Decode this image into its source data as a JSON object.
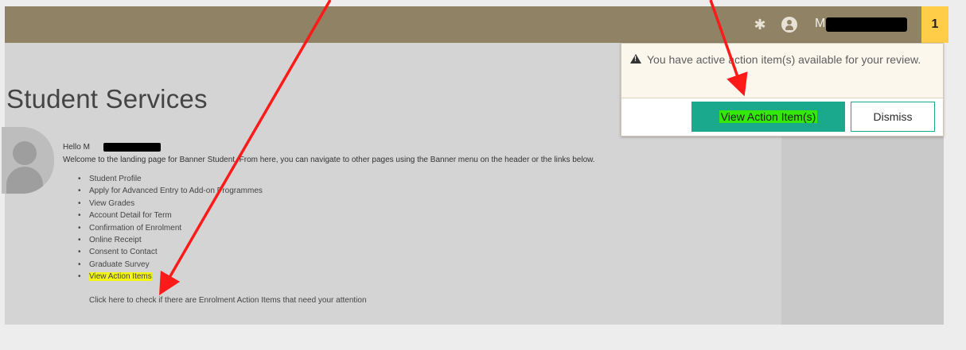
{
  "header": {
    "user_initial": "M",
    "notification_count": "1"
  },
  "main": {
    "title": "Student Services",
    "greeting": "Hello M",
    "welcome": "Welcome to the landing page for Banner Student. From here, you can navigate to other pages using the Banner menu on the header or the links below.",
    "links": [
      {
        "label": "Student Profile"
      },
      {
        "label": "Apply for Advanced Entry to Add-on Programmes"
      },
      {
        "label": "View Grades"
      },
      {
        "label": "Account Detail for Term"
      },
      {
        "label": "Confirmation of Enrolment"
      },
      {
        "label": "Online Receipt"
      },
      {
        "label": "Consent to Contact"
      },
      {
        "label": "Graduate Survey"
      },
      {
        "label": "View Action Items"
      }
    ],
    "action_items_description": "Click here to check if there are Enrolment Action Items that need your attention"
  },
  "popup": {
    "message": "You have active action item(s) available for your review.",
    "view_button": "View Action Item(s)",
    "dismiss_button": "Dismiss"
  },
  "colors": {
    "header_bg": "#8f8265",
    "notification_badge": "#ffcd48",
    "primary_button": "#1aa98d",
    "highlight_yellow": "#f3f316",
    "highlight_green": "#35e80b",
    "annotation_arrow": "#ff1a1a"
  },
  "icons": [
    "gear-icon",
    "user-icon",
    "warning-icon"
  ]
}
